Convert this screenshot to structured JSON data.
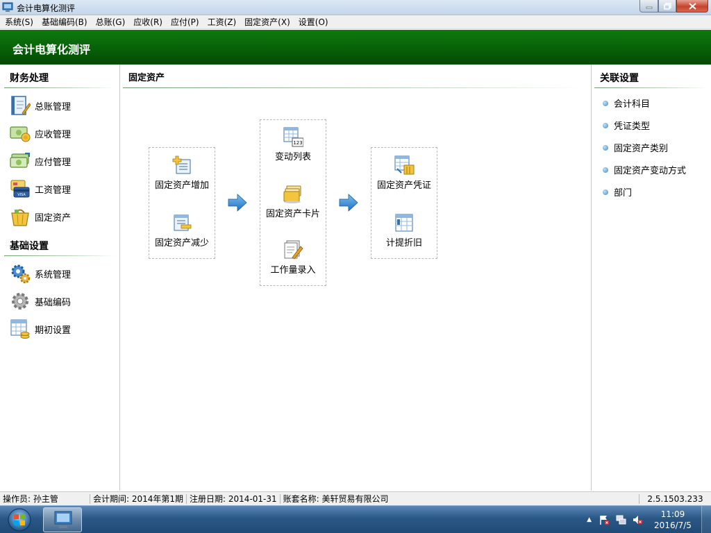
{
  "window": {
    "title": "会计电算化测评"
  },
  "menu": [
    {
      "label": "系统(S)"
    },
    {
      "label": "基础编码(B)"
    },
    {
      "label": "总账(G)"
    },
    {
      "label": "应收(R)"
    },
    {
      "label": "应付(P)"
    },
    {
      "label": "工资(Z)"
    },
    {
      "label": "固定资产(X)"
    },
    {
      "label": "设置(O)"
    }
  ],
  "banner": {
    "title": "会计电算化测评"
  },
  "left": {
    "finance_title": "财务处理",
    "finance_items": [
      {
        "label": "总账管理",
        "icon": "ledger-icon"
      },
      {
        "label": "应收管理",
        "icon": "receivable-money-icon"
      },
      {
        "label": "应付管理",
        "icon": "payable-money-icon"
      },
      {
        "label": "工资管理",
        "icon": "payroll-card-icon"
      },
      {
        "label": "固定资产",
        "icon": "fixed-asset-basket-icon"
      }
    ],
    "basic_title": "基础设置",
    "basic_items": [
      {
        "label": "系统管理",
        "icon": "gears-icon"
      },
      {
        "label": "基础编码",
        "icon": "gear-icon"
      },
      {
        "label": "期初设置",
        "icon": "spreadsheet-coins-icon"
      }
    ]
  },
  "center": {
    "title": "固定资产",
    "col1": [
      {
        "label": "固定资产增加",
        "icon": "asset-add-icon"
      },
      {
        "label": "固定资产减少",
        "icon": "asset-reduce-icon"
      }
    ],
    "col2": [
      {
        "label": "变动列表",
        "icon": "change-list-icon"
      },
      {
        "label": "固定资产卡片",
        "icon": "asset-card-icon"
      },
      {
        "label": "工作量录入",
        "icon": "workload-entry-icon"
      }
    ],
    "col3": [
      {
        "label": "固定资产凭证",
        "icon": "asset-voucher-icon"
      },
      {
        "label": "计提折旧",
        "icon": "depreciation-icon"
      }
    ]
  },
  "right": {
    "title": "关联设置",
    "links": [
      {
        "label": "会计科目"
      },
      {
        "label": "凭证类型"
      },
      {
        "label": "固定资产类别"
      },
      {
        "label": "固定资产变动方式"
      },
      {
        "label": "部门"
      }
    ]
  },
  "status": {
    "operator": "操作员: 孙主管",
    "period": "会计期间: 2014年第1期",
    "login_date": "注册日期: 2014-01-31",
    "account_name": "账套名称: 美轩贸易有限公司",
    "version": "2.5.1503.233"
  },
  "taskbar": {
    "time": "11:09",
    "date": "2016/7/5"
  },
  "colors": {
    "banner_green": "#075e07",
    "link_bullet": "#3f8fc8",
    "taskbar_blue": "#2a5886"
  }
}
